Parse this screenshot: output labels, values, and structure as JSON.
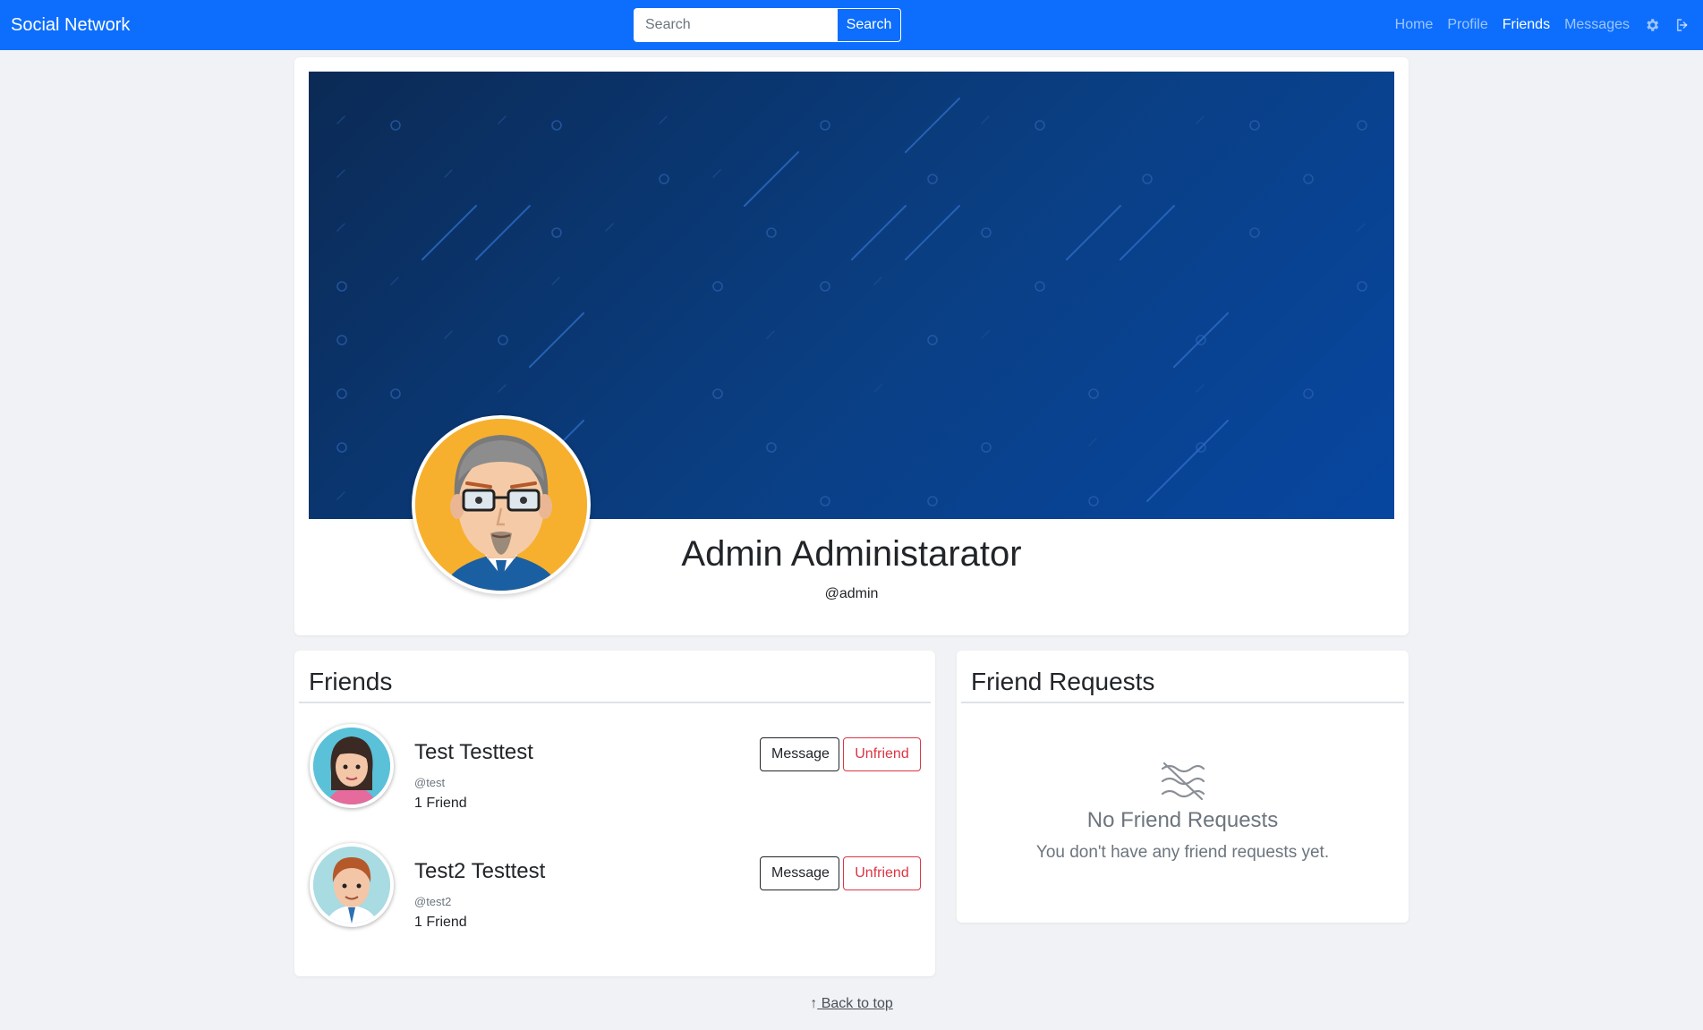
{
  "navbar": {
    "brand": "Social Network",
    "search_placeholder": "Search",
    "search_button": "Search",
    "links": [
      {
        "label": "Home",
        "active": false
      },
      {
        "label": "Profile",
        "active": false
      },
      {
        "label": "Friends",
        "active": true
      },
      {
        "label": "Messages",
        "active": false
      }
    ],
    "icons": [
      "gear-icon",
      "logout-icon"
    ],
    "color": "#0d6efd"
  },
  "profile": {
    "name": "Admin Administarator",
    "handle": "@admin",
    "avatar": "man-with-glasses-avatar"
  },
  "friends": {
    "title": "Friends",
    "items": [
      {
        "name": "Test Testtest",
        "handle": "@test",
        "count": "1 Friend",
        "message_label": "Message",
        "unfriend_label": "Unfriend",
        "avatar": "woman-avatar"
      },
      {
        "name": "Test2 Testtest",
        "handle": "@test2",
        "count": "1 Friend",
        "message_label": "Message",
        "unfriend_label": "Unfriend",
        "avatar": "man-avatar"
      }
    ]
  },
  "requests": {
    "title": "Friend Requests",
    "empty_icon": "no-connection-icon",
    "empty_title": "No Friend Requests",
    "empty_text": "You don't have any friend requests yet."
  },
  "footer": {
    "back_to_top": " Back to top",
    "arrow_icon": "arrow-up-icon"
  }
}
